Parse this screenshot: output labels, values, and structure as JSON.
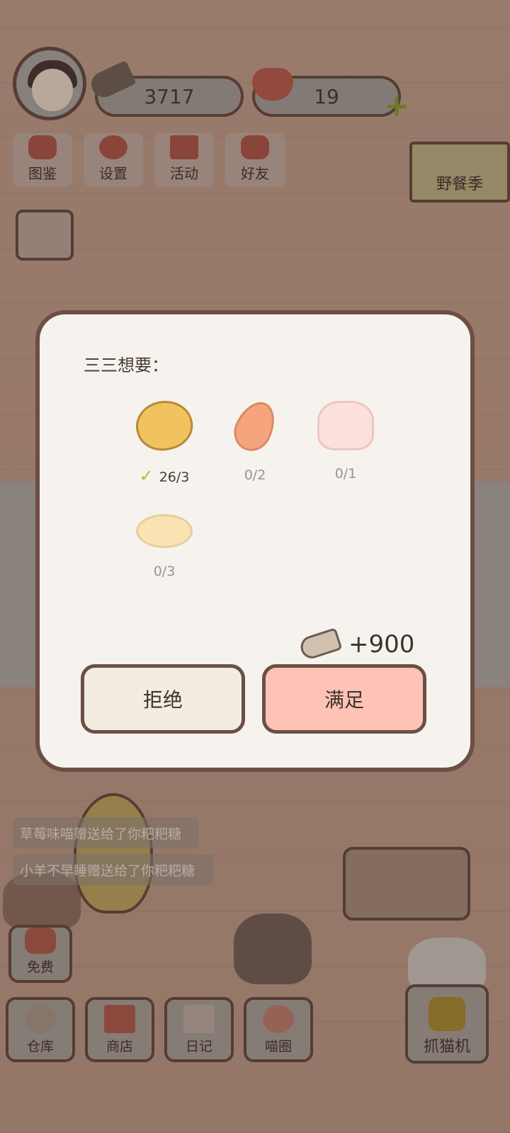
{
  "hud": {
    "coins": "3717",
    "hearts": "19",
    "plus_icon": "plus-icon"
  },
  "menu": [
    {
      "label": "图鉴",
      "icon": "cat-head-icon"
    },
    {
      "label": "设置",
      "icon": "gear-icon"
    },
    {
      "label": "活动",
      "icon": "gift-icon"
    },
    {
      "label": "好友",
      "icon": "friends-icon"
    }
  ],
  "event_banner": {
    "label": "野餐季"
  },
  "dialog": {
    "title": "三三想要：",
    "requirements": [
      {
        "item": "potato",
        "count": "26/3",
        "fulfilled": true
      },
      {
        "item": "carrot",
        "count": "0/2",
        "fulfilled": false
      },
      {
        "item": "jelly",
        "count": "0/1",
        "fulfilled": false
      },
      {
        "item": "rice",
        "count": "0/3",
        "fulfilled": false
      }
    ],
    "reward": "+900",
    "reject_label": "拒绝",
    "accept_label": "满足"
  },
  "notifications": [
    "草莓味喵赠送给了你粑粑糖",
    "小羊不早睡赠送给了你粑粑糖"
  ],
  "free_button": {
    "label": "免费"
  },
  "bottom_nav": [
    {
      "label": "仓库"
    },
    {
      "label": "商店"
    },
    {
      "label": "日记"
    },
    {
      "label": "喵圈"
    }
  ],
  "catch_button": {
    "label": "抓猫机"
  },
  "colors": {
    "dialog_bg": "#f6f3ee",
    "accept_bg": "#ffc2b6",
    "reject_bg": "#f2ede0",
    "border": "#6b4f45"
  }
}
